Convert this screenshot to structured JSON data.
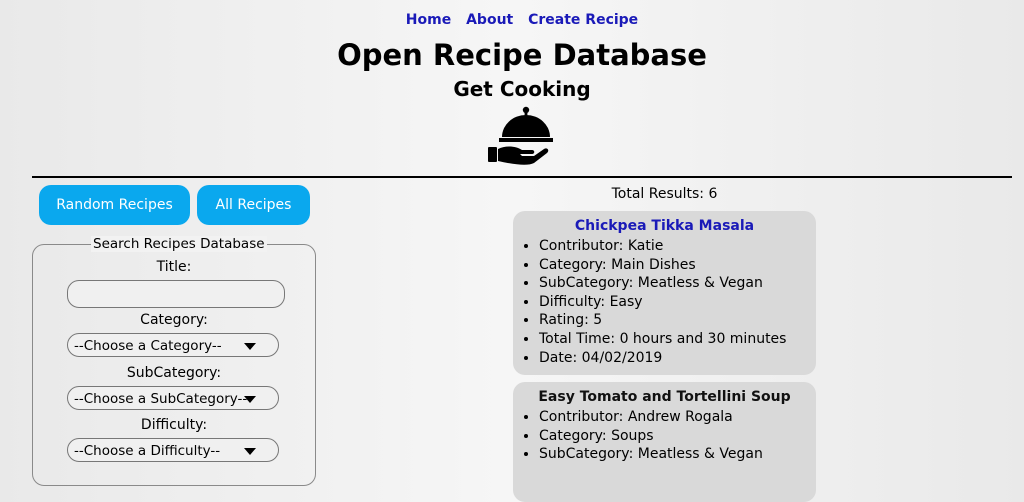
{
  "nav": {
    "items": [
      "Home",
      "About",
      "Create Recipe"
    ]
  },
  "header": {
    "title": "Open Recipe Database",
    "subtitle": "Get Cooking"
  },
  "buttons": {
    "random": "Random Recipes",
    "all": "All Recipes"
  },
  "search": {
    "legend": "Search Recipes Database",
    "title_label": "Title:",
    "title_value": "",
    "category_label": "Category:",
    "category_value": "--Choose a Category--",
    "subcategory_label": "SubCategory:",
    "subcategory_value": "--Choose a SubCategory--",
    "difficulty_label": "Difficulty:",
    "difficulty_value": "--Choose a Difficulty--"
  },
  "results": {
    "total_label": "Total Results: 6",
    "cards": [
      {
        "title": "Chickpea Tikka Masala",
        "fields": [
          "Contributor: Katie",
          "Category: Main Dishes",
          "SubCategory: Meatless & Vegan",
          "Difficulty: Easy",
          "Rating: 5",
          "Total Time: 0 hours and 30 minutes",
          "Date: 04/02/2019"
        ]
      },
      {
        "title": "Easy Tomato and Tortellini Soup",
        "fields": [
          "Contributor: Andrew Rogala",
          "Category: Soups",
          "SubCategory: Meatless & Vegan"
        ]
      }
    ]
  },
  "icons": {
    "logo": "serving-cloche-hand-icon",
    "dropdown": "caret-down-icon"
  },
  "colors": {
    "link": "#1a1ab8",
    "button": "#0aa8ee",
    "card": "#d9d9d9"
  }
}
